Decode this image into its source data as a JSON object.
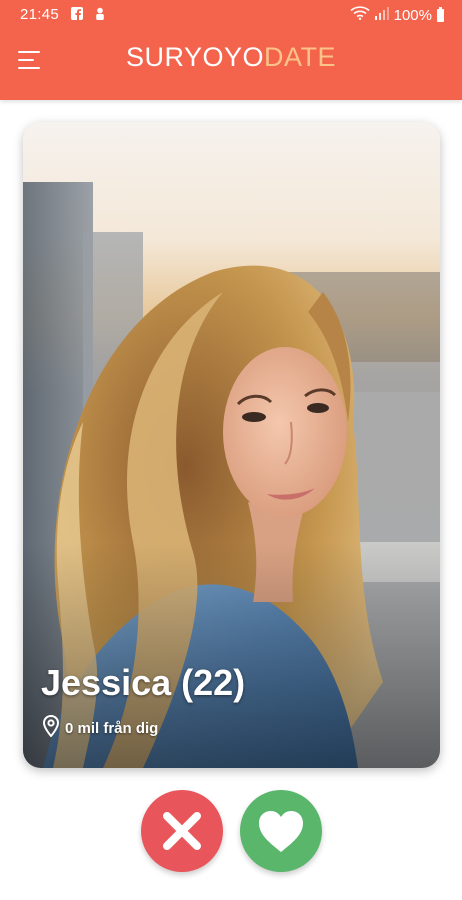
{
  "status_bar": {
    "time": "21:45",
    "notification_icons": [
      "facebook-icon",
      "person-notification-icon"
    ],
    "battery": "100%",
    "icons": [
      "wifi-icon",
      "signal-icon",
      "battery-icon"
    ]
  },
  "header": {
    "logo_part1": "SURYOYO",
    "logo_part2": "DATE",
    "menu_icon": "hamburger-menu-icon",
    "color": "#f4644d"
  },
  "profile": {
    "name_age": "Jessica (22)",
    "distance": "0 mil från dig",
    "distance_icon": "location-pin-icon"
  },
  "actions": {
    "dislike_icon": "close-icon",
    "dislike_color": "#e8555a",
    "like_icon": "heart-icon",
    "like_color": "#59b66b"
  }
}
